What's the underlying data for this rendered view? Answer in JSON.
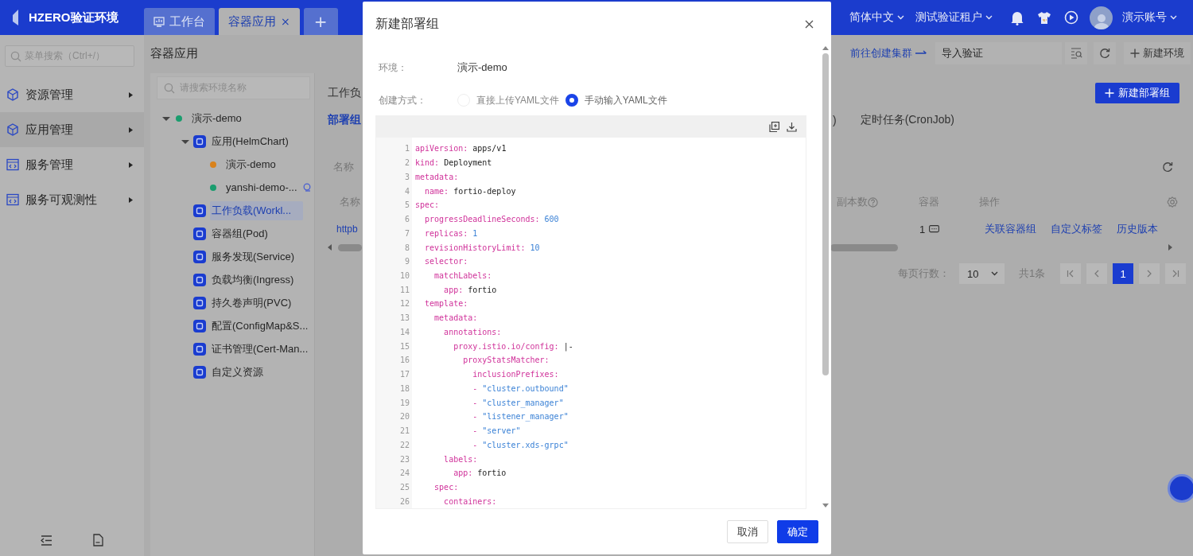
{
  "header": {
    "logo": "HZERO验证环境",
    "tabs": [
      {
        "label": "工作台",
        "kind": "home",
        "selected": false
      },
      {
        "label": "容器应用",
        "kind": "page",
        "selected": true,
        "close": "×"
      },
      {
        "label": "+",
        "kind": "add",
        "selected": false
      }
    ],
    "language": "简体中文",
    "tenant": "测试验证租户",
    "user": "演示账号"
  },
  "sidebar": {
    "search": {
      "placeholder": "菜单搜索（Ctrl+/）"
    },
    "items": [
      {
        "label": "资源管理",
        "kind": "cube",
        "selected": false
      },
      {
        "label": "应用管理",
        "kind": "cube",
        "selected": true
      },
      {
        "label": "服务管理",
        "kind": "code",
        "selected": false
      },
      {
        "label": "服务可观测性",
        "kind": "code",
        "selected": false
      }
    ]
  },
  "page": {
    "title": "容器应用",
    "cluster_link": "前往创建集群",
    "import_field": {
      "value": "导入验证"
    },
    "new_env_button": "新建环境"
  },
  "tree": {
    "search": {
      "placeholder": "请搜索环境名称"
    },
    "nodes": [
      {
        "label": "演示-demo",
        "kind": "env",
        "color": "#1a9d6e",
        "expanded": true,
        "selected": false,
        "children": [
          {
            "label": "应用(HelmChart)",
            "kind": "resource",
            "expanded": true,
            "selected": false,
            "children": [
              {
                "label": "演示-demo",
                "kind": "instance",
                "color": "#d9821c",
                "marked": false,
                "selected": false
              },
              {
                "label": "yanshi-demo-...",
                "kind": "instance",
                "color": "#1a9d6e",
                "marked": true,
                "selected": false
              }
            ]
          },
          {
            "label": "工作负载(Workl...",
            "kind": "resource",
            "selected": true
          },
          {
            "label": "容器组(Pod)",
            "kind": "resource",
            "selected": false
          },
          {
            "label": "服务发现(Service)",
            "kind": "resource",
            "selected": false
          },
          {
            "label": "负载均衡(Ingress)",
            "kind": "resource",
            "selected": false
          },
          {
            "label": "持久卷声明(PVC)",
            "kind": "resource",
            "selected": false
          },
          {
            "label": "配置(ConfigMap&S...",
            "kind": "resource",
            "selected": false
          },
          {
            "label": "证书管理(Cert-Man...",
            "kind": "resource",
            "selected": false
          },
          {
            "label": "自定义资源",
            "kind": "resource",
            "selected": false
          }
        ]
      }
    ]
  },
  "workload": {
    "title": "工作负",
    "new_button": "新建部署组",
    "tabs": [
      {
        "label": "部署组",
        "selected": true
      },
      {
        "label": ")",
        "selected": false
      },
      {
        "label": "定时任务(CronJob)",
        "selected": false
      }
    ],
    "filter_label": "名称",
    "columns": [
      "名称",
      "副本数",
      "容器",
      "操作"
    ],
    "rows": [
      {
        "name": "httpb",
        "containers": "1",
        "actions": [
          "关联容器组",
          "自定义标签",
          "历史版本"
        ]
      }
    ],
    "pagination": {
      "rows_label": "每页行数：",
      "page_size": "10",
      "total": "共1条",
      "pages": [
        {
          "label": "1",
          "selected": true
        }
      ]
    }
  },
  "modal": {
    "title": "新建部署组",
    "env_label": "环境：",
    "env_value": "演示-demo",
    "method_label": "创建方式：",
    "methods": [
      {
        "label": "直接上传YAML文件",
        "selected": false
      },
      {
        "label": "手动输入YAML文件",
        "selected": true
      }
    ],
    "code": [
      {
        "n": "1",
        "parts": [
          {
            "kind": "key",
            "text": "apiVersion:"
          },
          {
            "kind": "plain",
            "text": " apps/v1"
          }
        ]
      },
      {
        "n": "2",
        "parts": [
          {
            "kind": "key",
            "text": "kind:"
          },
          {
            "kind": "plain",
            "text": " Deployment"
          }
        ]
      },
      {
        "n": "3",
        "parts": [
          {
            "kind": "key",
            "text": "metadata:"
          }
        ]
      },
      {
        "n": "4",
        "parts": [
          {
            "kind": "key",
            "text": "  name:"
          },
          {
            "kind": "plain",
            "text": " fortio-deploy"
          }
        ]
      },
      {
        "n": "5",
        "parts": [
          {
            "kind": "key",
            "text": "spec:"
          }
        ]
      },
      {
        "n": "6",
        "parts": [
          {
            "kind": "key",
            "text": "  progressDeadlineSeconds:"
          },
          {
            "kind": "number",
            "text": " 600"
          }
        ]
      },
      {
        "n": "7",
        "parts": [
          {
            "kind": "key",
            "text": "  replicas:"
          },
          {
            "kind": "number",
            "text": " 1"
          }
        ]
      },
      {
        "n": "8",
        "parts": [
          {
            "kind": "key",
            "text": "  revisionHistoryLimit:"
          },
          {
            "kind": "number",
            "text": " 10"
          }
        ]
      },
      {
        "n": "9",
        "parts": [
          {
            "kind": "key",
            "text": "  selector:"
          }
        ]
      },
      {
        "n": "10",
        "parts": [
          {
            "kind": "key",
            "text": "    matchLabels:"
          }
        ]
      },
      {
        "n": "11",
        "parts": [
          {
            "kind": "key",
            "text": "      app:"
          },
          {
            "kind": "plain",
            "text": " fortio"
          }
        ]
      },
      {
        "n": "12",
        "parts": [
          {
            "kind": "key",
            "text": "  template:"
          }
        ]
      },
      {
        "n": "13",
        "parts": [
          {
            "kind": "key",
            "text": "    metadata:"
          }
        ]
      },
      {
        "n": "14",
        "parts": [
          {
            "kind": "key",
            "text": "      annotations:"
          }
        ]
      },
      {
        "n": "15",
        "parts": [
          {
            "kind": "key",
            "text": "        proxy.istio.io/config:"
          },
          {
            "kind": "plain",
            "text": " |-"
          }
        ]
      },
      {
        "n": "16",
        "parts": [
          {
            "kind": "key",
            "text": "          proxyStatsMatcher:"
          }
        ]
      },
      {
        "n": "17",
        "parts": [
          {
            "kind": "key",
            "text": "            inclusionPrefixes:"
          }
        ]
      },
      {
        "n": "18",
        "parts": [
          {
            "kind": "key",
            "text": "            - "
          },
          {
            "kind": "string",
            "text": "\"cluster.outbound\""
          }
        ]
      },
      {
        "n": "19",
        "parts": [
          {
            "kind": "key",
            "text": "            - "
          },
          {
            "kind": "string",
            "text": "\"cluster_manager\""
          }
        ]
      },
      {
        "n": "20",
        "parts": [
          {
            "kind": "key",
            "text": "            - "
          },
          {
            "kind": "string",
            "text": "\"listener_manager\""
          }
        ]
      },
      {
        "n": "21",
        "parts": [
          {
            "kind": "key",
            "text": "            - "
          },
          {
            "kind": "string",
            "text": "\"server\""
          }
        ]
      },
      {
        "n": "22",
        "parts": [
          {
            "kind": "key",
            "text": "            - "
          },
          {
            "kind": "string",
            "text": "\"cluster.xds-grpc\""
          }
        ]
      },
      {
        "n": "23",
        "parts": [
          {
            "kind": "key",
            "text": "      labels:"
          }
        ]
      },
      {
        "n": "24",
        "parts": [
          {
            "kind": "key",
            "text": "        app:"
          },
          {
            "kind": "plain",
            "text": " fortio"
          }
        ]
      },
      {
        "n": "25",
        "parts": [
          {
            "kind": "key",
            "text": "    spec:"
          }
        ]
      },
      {
        "n": "26",
        "parts": [
          {
            "kind": "key",
            "text": "      containers:"
          }
        ]
      }
    ],
    "buttons": [
      {
        "label": "取消",
        "kind": "default"
      },
      {
        "label": "确定",
        "kind": "primary"
      }
    ]
  }
}
